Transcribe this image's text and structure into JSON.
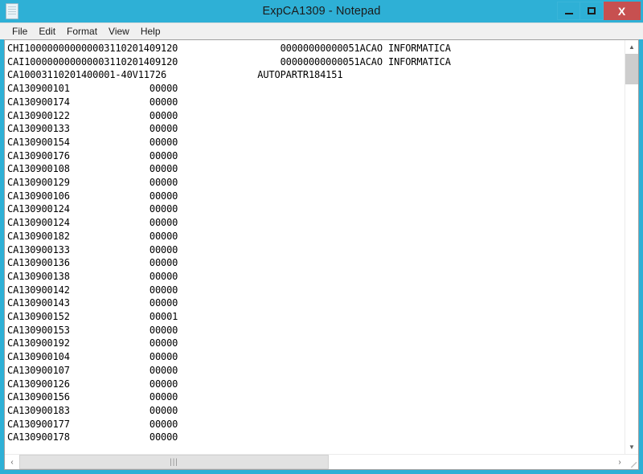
{
  "window": {
    "title": "ExpCA1309 - Notepad",
    "icon": "notepad-document-icon",
    "accent_color": "#2eb0d6",
    "close_color": "#c75050",
    "controls": {
      "minimize": "–",
      "maximize": "□",
      "close": "X"
    }
  },
  "menu": {
    "items": [
      {
        "label": "File"
      },
      {
        "label": "Edit"
      },
      {
        "label": "Format"
      },
      {
        "label": "View"
      },
      {
        "label": "Help"
      }
    ]
  },
  "editor": {
    "text": "CHI100000000000003110201409120                  00000000000051ACAO INFORMATICA\nCAI100000000000003110201409120                  00000000000051ACAO INFORMATICA\nCA10003110201400001-40V11726                AUTOPARTR184151\nCA130900101              00000\nCA130900174              00000\nCA130900122              00000\nCA130900133              00000\nCA130900154              00000\nCA130900176              00000\nCA130900108              00000\nCA130900129              00000\nCA130900106              00000\nCA130900124              00000\nCA130900124              00000\nCA130900182              00000\nCA130900133              00000\nCA130900136              00000\nCA130900138              00000\nCA130900142              00000\nCA130900143              00000\nCA130900152              00001\nCA130900153              00000\nCA130900192              00000\nCA130900104              00000\nCA130900107              00000\nCA130900126              00000\nCA130900156              00000\nCA130900183              00000\nCA130900177              00000\nCA130900178              00000",
    "lines": [
      {
        "col1": "CHI100000000000003110201409120",
        "col2": "00000000000051ACAO INFORMATICA"
      },
      {
        "col1": "CAI100000000000003110201409120",
        "col2": "00000000000051ACAO INFORMATICA"
      },
      {
        "col1": "CA10003110201400001-40V11726",
        "col2": "AUTOPARTR184151"
      },
      {
        "col1": "CA130900101",
        "col2": "00000"
      },
      {
        "col1": "CA130900174",
        "col2": "00000"
      },
      {
        "col1": "CA130900122",
        "col2": "00000"
      },
      {
        "col1": "CA130900133",
        "col2": "00000"
      },
      {
        "col1": "CA130900154",
        "col2": "00000"
      },
      {
        "col1": "CA130900176",
        "col2": "00000"
      },
      {
        "col1": "CA130900108",
        "col2": "00000"
      },
      {
        "col1": "CA130900129",
        "col2": "00000"
      },
      {
        "col1": "CA130900106",
        "col2": "00000"
      },
      {
        "col1": "CA130900124",
        "col2": "00000"
      },
      {
        "col1": "CA130900124",
        "col2": "00000"
      },
      {
        "col1": "CA130900182",
        "col2": "00000"
      },
      {
        "col1": "CA130900133",
        "col2": "00000"
      },
      {
        "col1": "CA130900136",
        "col2": "00000"
      },
      {
        "col1": "CA130900138",
        "col2": "00000"
      },
      {
        "col1": "CA130900142",
        "col2": "00000"
      },
      {
        "col1": "CA130900143",
        "col2": "00000"
      },
      {
        "col1": "CA130900152",
        "col2": "00001"
      },
      {
        "col1": "CA130900153",
        "col2": "00000"
      },
      {
        "col1": "CA130900192",
        "col2": "00000"
      },
      {
        "col1": "CA130900104",
        "col2": "00000"
      },
      {
        "col1": "CA130900107",
        "col2": "00000"
      },
      {
        "col1": "CA130900126",
        "col2": "00000"
      },
      {
        "col1": "CA130900156",
        "col2": "00000"
      },
      {
        "col1": "CA130900183",
        "col2": "00000"
      },
      {
        "col1": "CA130900177",
        "col2": "00000"
      },
      {
        "col1": "CA130900178",
        "col2": "00000"
      }
    ]
  },
  "scrollbars": {
    "vertical": {
      "up_arrow": "▲",
      "down_arrow": "▼"
    },
    "horizontal": {
      "left_arrow": "‹",
      "right_arrow": "›",
      "thumb_grip": "|||"
    }
  }
}
